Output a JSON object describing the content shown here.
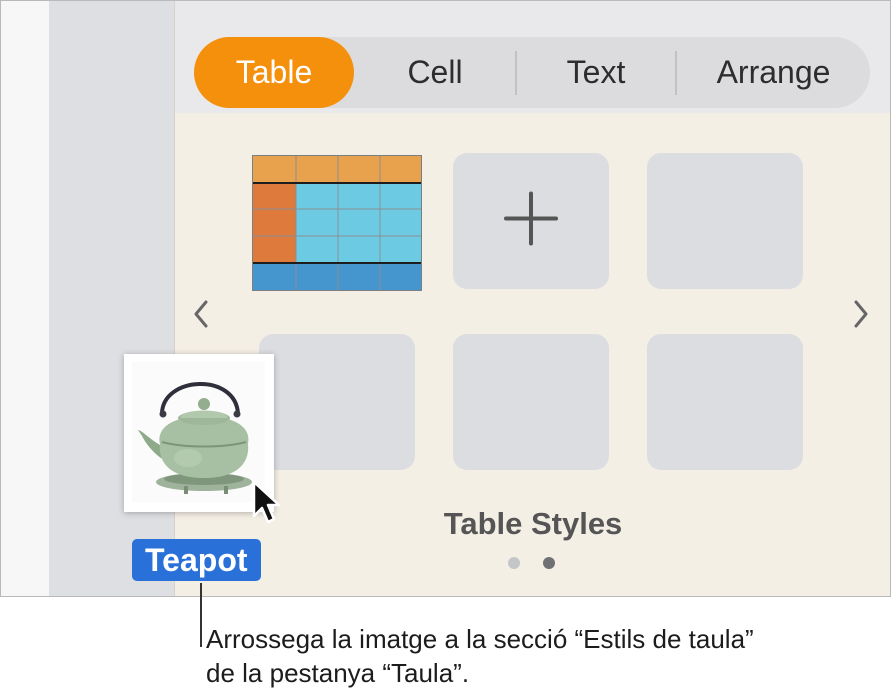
{
  "tabs": [
    {
      "label": "Table",
      "active": true
    },
    {
      "label": "Cell",
      "active": false
    },
    {
      "label": "Text",
      "active": false
    },
    {
      "label": "Arrange",
      "active": false
    }
  ],
  "styles": {
    "section_title": "Table Styles",
    "page": {
      "current": 2,
      "total": 2
    }
  },
  "drag": {
    "label": "Teapot"
  },
  "caption": {
    "line1": "Arrossega la imatge a la secció “Estils de taula”",
    "line2": "de la pestanya “Taula”."
  },
  "colors": {
    "accent": "#f4900c",
    "label_blue": "#2a70d9",
    "header_orange": "#e8a14d",
    "side_orange": "#de7a3c",
    "cell_blue": "#6ccbe2",
    "footer_blue": "#4596cf"
  },
  "icons": {
    "add_style": "plus-icon",
    "prev": "chevron-left-icon",
    "next": "chevron-right-icon",
    "pointer": "cursor-arrow-icon"
  }
}
